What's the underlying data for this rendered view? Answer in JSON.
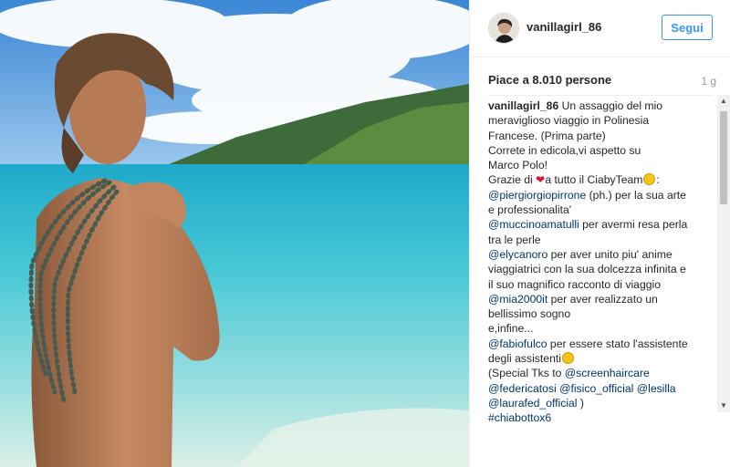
{
  "post": {
    "username": "vanillagirl_86",
    "follow_label": "Segui",
    "likes": "Piace a 8.010 persone",
    "time": "1 g"
  },
  "caption": {
    "username": "vanillagirl_86",
    "l1": " Un assaggio del mio",
    "l2": "meraviglioso viaggio in Polinesia",
    "l3": "Francese. (Prima parte)",
    "l4": "Correte in edicola,vi aspetto su",
    "l5": "Marco Polo!",
    "l6a": "Grazie di ",
    "heart": "❤",
    "l6b": "a tutto il CiabyTeam",
    "l6c": ":",
    "m1": "@piergiorgiopirrone",
    "l7": " (ph.) per la sua arte",
    "l8": "e professionalita'",
    "m2": "@muccinoamatulli",
    "l9": " per avermi resa perla",
    "l10": "tra le perle",
    "m3": "@elycanoro",
    "l11": " per aver unito piu' anime",
    "l12": "viaggiatrici con la sua dolcezza infinita e",
    "l13": "il suo magnifico racconto di viaggio",
    "m4": "@mia2000it",
    "l14": " per aver realizzato un",
    "l15": "bellissimo sogno",
    "l16": "e,infine...",
    "m5": "@fabiofulco",
    "l17": " per essere stato l'assistente",
    "l18": "degli assistenti",
    "l19": "(Special Tks to ",
    "m6": "@screenhaircare",
    "m7": "@federicatosi",
    "m8": "@fisico_official",
    "m9": "@lesilla",
    "m10": "@laurafed_official",
    "l20": " )",
    "m11": "#chiabottox6"
  },
  "colors": {
    "follow": "#3897f0",
    "mention": "#003569",
    "heart": "#d8112c"
  },
  "icons": [
    "smile-emoji-icon",
    "heart-icon",
    "scroll-up-icon",
    "scroll-down-icon"
  ]
}
